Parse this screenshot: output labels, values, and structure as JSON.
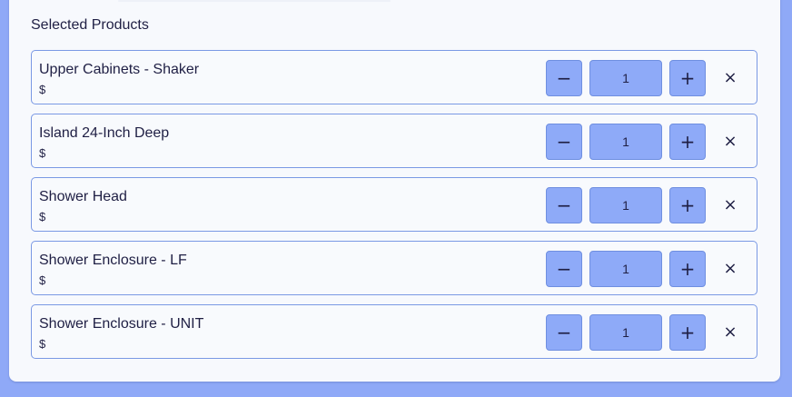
{
  "selected_products": {
    "title": "Selected Products",
    "icons": {
      "decrement": "minus-icon",
      "increment": "plus-icon",
      "remove": "close-icon"
    },
    "controls": {
      "decrement_glyph": "−",
      "increment_glyph": "+",
      "remove_glyph": "×"
    },
    "items": [
      {
        "name": "Upper Cabinets - Shaker",
        "price": "$",
        "quantity": "1"
      },
      {
        "name": "Island 24-Inch Deep",
        "price": "$",
        "quantity": "1"
      },
      {
        "name": "Shower Head",
        "price": "$",
        "quantity": "1"
      },
      {
        "name": "Shower Enclosure - LF",
        "price": "$",
        "quantity": "1"
      },
      {
        "name": "Shower Enclosure - UNIT",
        "price": "$",
        "quantity": "1"
      }
    ]
  },
  "colors": {
    "page_background": "#8fa9f7",
    "panel_background": "#f7f9fd",
    "row_border": "#7a99e4",
    "control_fill": "#8eaaf8",
    "text": "#1f1f44"
  }
}
